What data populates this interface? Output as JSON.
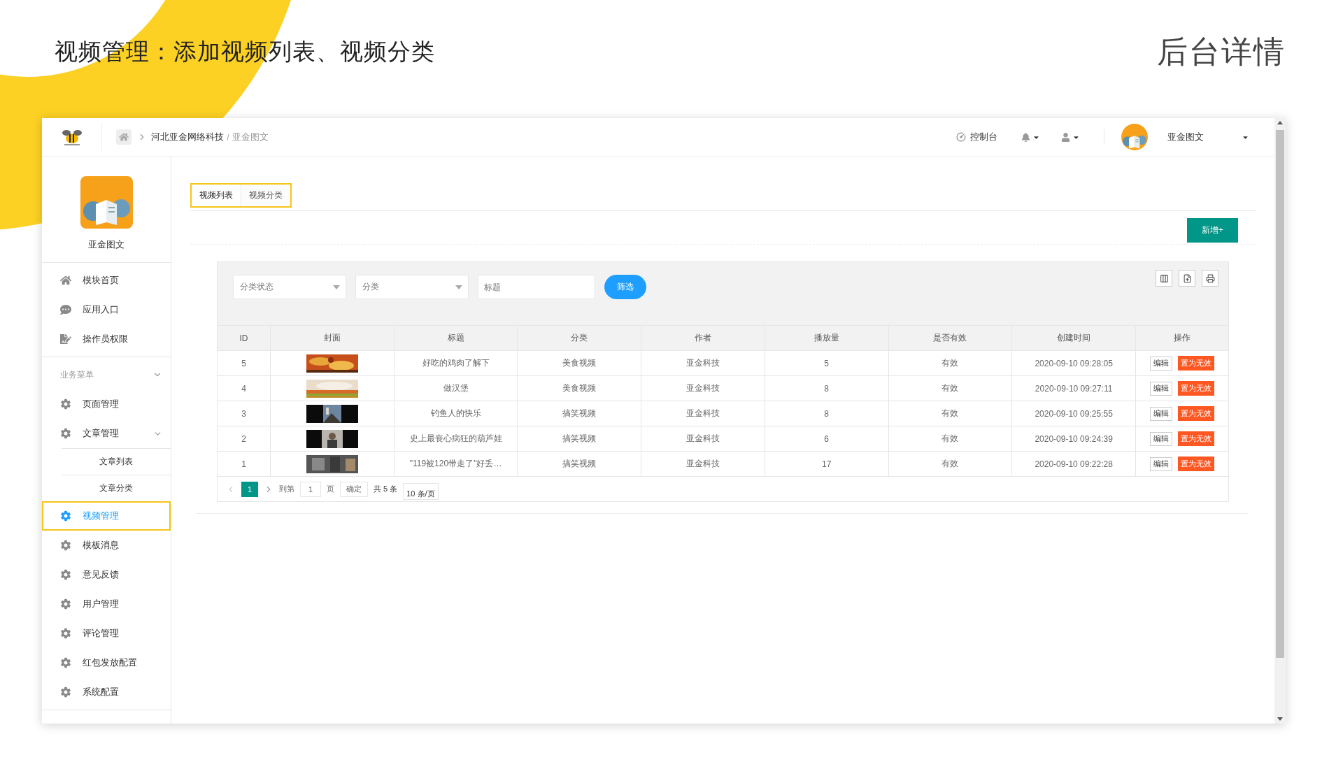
{
  "page_heading": "视频管理：添加视频列表、视频分类",
  "page_tag": "后台详情",
  "header": {
    "breadcrumb": "河北亚金网络科技",
    "separator": "/",
    "current": "亚金图文",
    "console": "控制台",
    "user_name": "亚金图文"
  },
  "sidebar": {
    "app_name": "亚金图文",
    "top_items": [
      {
        "label": "模块首页",
        "kind": "home"
      },
      {
        "label": "应用入口",
        "kind": "chat"
      },
      {
        "label": "操作员权限",
        "kind": "doc"
      }
    ],
    "section": {
      "label": "业务菜单",
      "expanded": true
    },
    "menu": [
      {
        "label": "页面管理",
        "selected": false
      },
      {
        "label": "文章管理",
        "selected": false,
        "expanded": true,
        "children": [
          {
            "label": "文章列表",
            "selected": false
          },
          {
            "label": "文章分类",
            "selected": false
          }
        ]
      },
      {
        "label": "视频管理",
        "selected": true
      },
      {
        "label": "模板消息",
        "selected": false
      },
      {
        "label": "意见反馈",
        "selected": false
      },
      {
        "label": "用户管理",
        "selected": false
      },
      {
        "label": "评论管理",
        "selected": false
      },
      {
        "label": "红包发放配置",
        "selected": false
      },
      {
        "label": "系统配置",
        "selected": false
      }
    ]
  },
  "tabs": [
    {
      "label": "视频列表",
      "selected": true
    },
    {
      "label": "视频分类",
      "selected": false
    }
  ],
  "new_button": "新增+",
  "filters": [
    {
      "kind": "select",
      "placeholder": "分类状态"
    },
    {
      "kind": "select",
      "placeholder": "分类"
    },
    {
      "kind": "input",
      "placeholder": "标题"
    }
  ],
  "filter_button": "筛选",
  "table": {
    "columns": [
      "ID",
      "封面",
      "标题",
      "分类",
      "作者",
      "播放量",
      "是否有效",
      "创建时间",
      "操作"
    ],
    "rows": [
      {
        "id": "5",
        "title": "好吃的鸡肉了解下",
        "category": "美食视频",
        "author": "亚金科技",
        "plays": "5",
        "valid": "有效",
        "created": "2020-09-10 09:28:05",
        "actions": [
          "编辑",
          "置为无效"
        ]
      },
      {
        "id": "4",
        "title": "做汉堡",
        "category": "美食视频",
        "author": "亚金科技",
        "plays": "8",
        "valid": "有效",
        "created": "2020-09-10 09:27:11",
        "actions": [
          "编辑",
          "置为无效"
        ]
      },
      {
        "id": "3",
        "title": "钓鱼人的快乐",
        "category": "搞笑视频",
        "author": "亚金科技",
        "plays": "8",
        "valid": "有效",
        "created": "2020-09-10 09:25:55",
        "actions": [
          "编辑",
          "置为无效"
        ]
      },
      {
        "id": "2",
        "title": "史上最丧心病狂的葫芦娃",
        "category": "搞笑视频",
        "author": "亚金科技",
        "plays": "6",
        "valid": "有效",
        "created": "2020-09-10 09:24:39",
        "actions": [
          "编辑",
          "置为无效"
        ]
      },
      {
        "id": "1",
        "title": "\"119被120带走了\"好丢…",
        "category": "搞笑视频",
        "author": "亚金科技",
        "plays": "17",
        "valid": "有效",
        "created": "2020-09-10 09:22:28",
        "actions": [
          "编辑",
          "置为无效"
        ]
      }
    ]
  },
  "pagination": {
    "pages": [
      {
        "label": "1",
        "selected": true
      }
    ],
    "goto": "到第",
    "page_input": "1",
    "page_unit": "页",
    "confirm": "确定",
    "total": "共 5 条",
    "page_size": "10 条/页"
  }
}
